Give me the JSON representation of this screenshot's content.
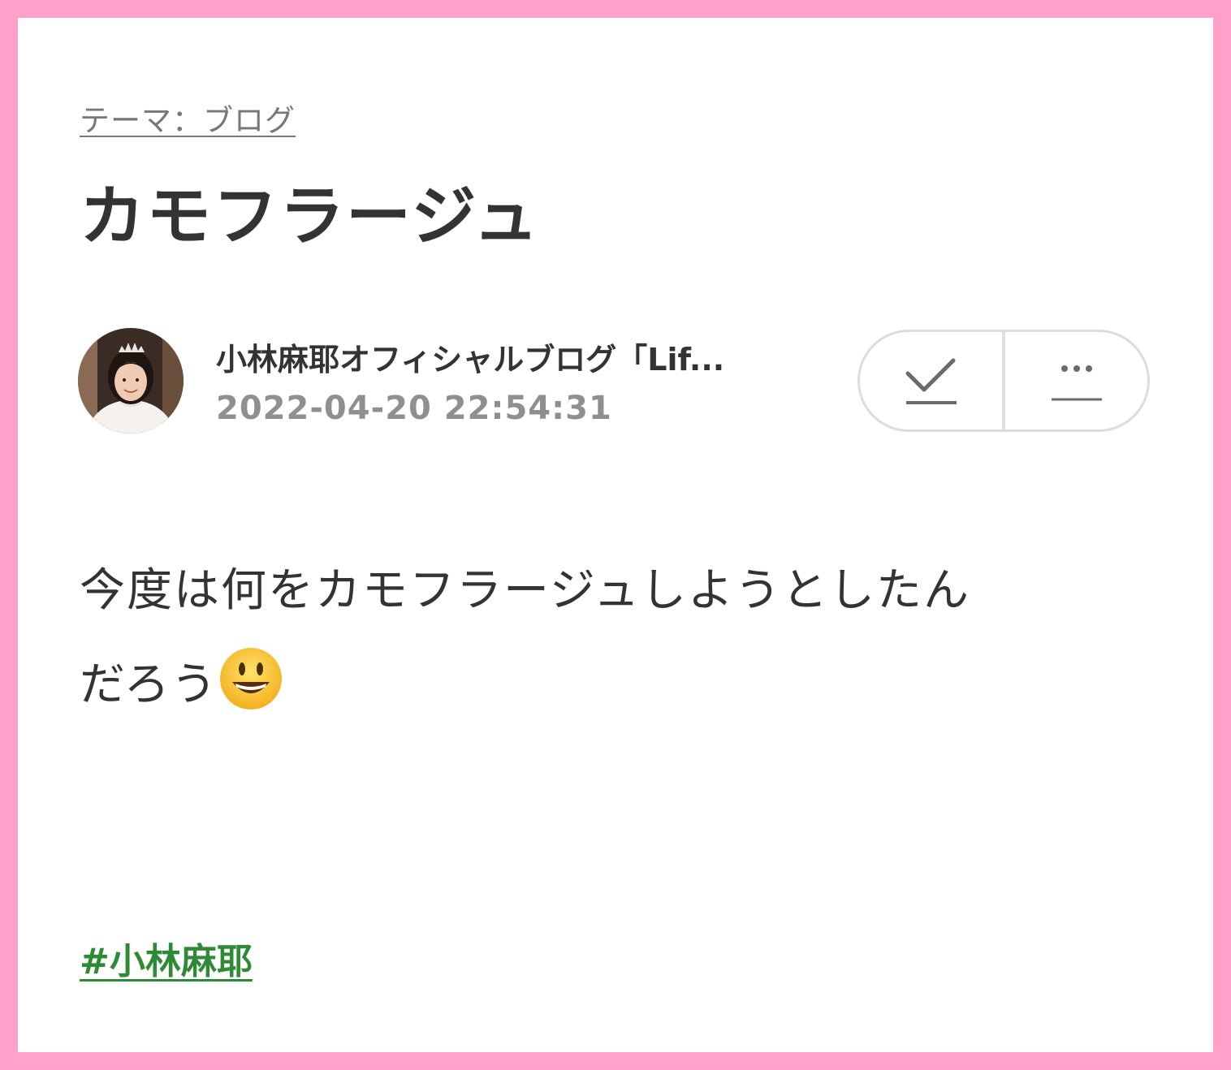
{
  "theme": {
    "label": "テーマ：ブログ"
  },
  "post": {
    "title": "カモフラージュ",
    "body_line1": "今度は何をカモフラージュしようとしたん",
    "body_line2": "だろう",
    "emoji": "smiling-face-icon"
  },
  "author": {
    "blog_name": "小林麻耶オフィシャルブログ「Lif...",
    "date": "2022-04-20 22:54:31",
    "avatar": "author-avatar-photo"
  },
  "actions": {
    "check_icon": "check-mark-icon",
    "more_icon": "more-dots-icon"
  },
  "hashtags": [
    "#小林麻耶"
  ],
  "colors": {
    "frame": "#ffa1c8",
    "hashtag": "#2f8a35",
    "date": "#8f8f8f",
    "text": "#333333"
  }
}
